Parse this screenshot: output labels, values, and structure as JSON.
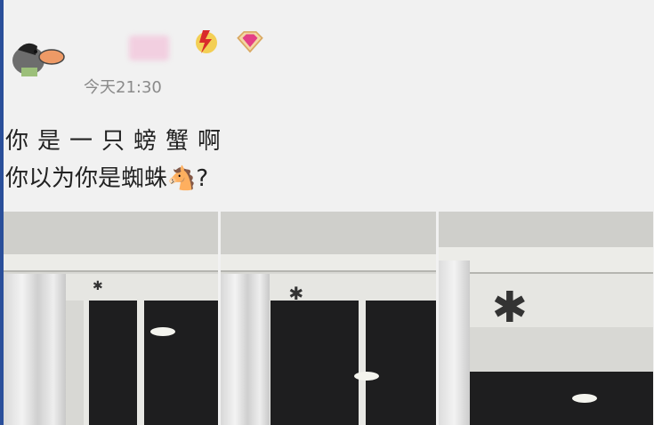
{
  "post": {
    "timestamp": "今天21:30",
    "lines": [
      "你是一只螃蟹啊",
      "你以为你是蜘蛛",
      "?"
    ],
    "emoji": "🐴"
  },
  "icons": [
    "avatar-duck",
    "lightning-badge-icon",
    "diamond-badge-icon"
  ],
  "colors": {
    "accent_edge": "#2a4f9a",
    "background": "#f1f1f1"
  }
}
